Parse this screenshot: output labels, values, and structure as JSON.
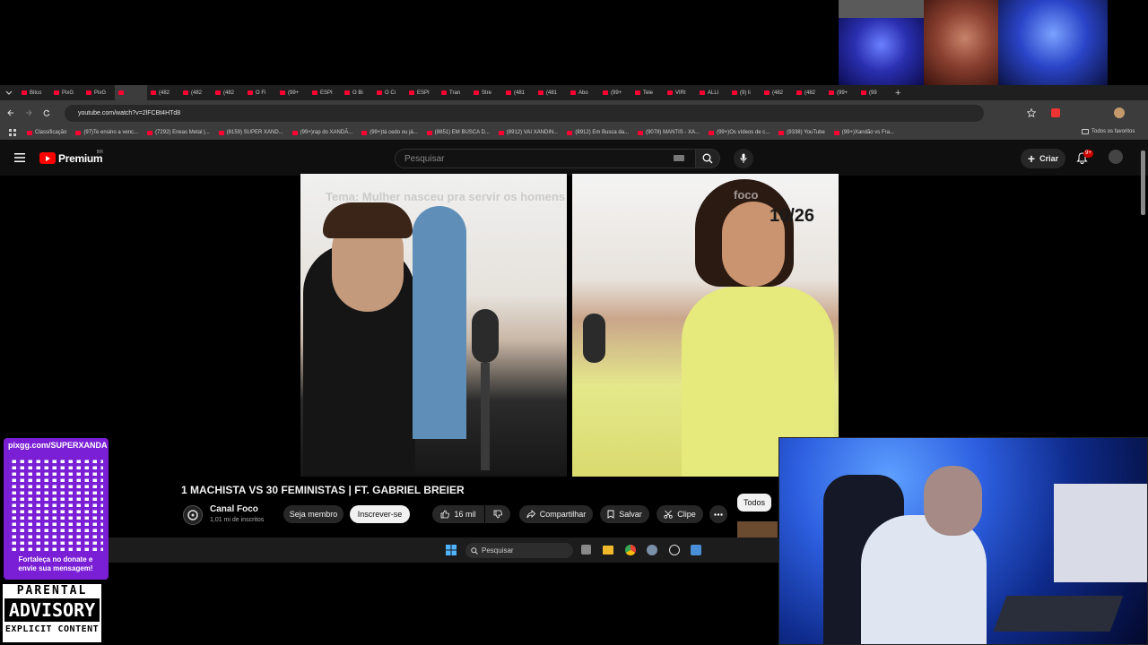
{
  "browser": {
    "tabs": [
      "Bitco",
      "PixG",
      "PixG",
      "",
      "(482",
      "(482",
      "(482",
      "O Fi",
      "(99+",
      "ESPI",
      "O Bi",
      "O Ci",
      "ESPI",
      "Tran",
      "Stre",
      "(481",
      "(481",
      "Abo",
      "(99+",
      "Tele",
      "VIRI",
      "ALLI",
      "(9) li",
      "(482",
      "(482",
      "(99+",
      "(99"
    ],
    "url": "youtube.com/watch?v=2lFCBt4HTd8",
    "bookmarks": [
      "Classificação",
      "(97)Te ensino a venc...",
      "(7292) Eneas Metal |...",
      "(8159) SUPER XAND...",
      "(99+)rap do XANDÃ...",
      "(99+)tá cedo ou já...",
      "(8851) EM BUSCA D...",
      "(8912) VAI XANDIN...",
      "(8912) Em Busca da...",
      "(9078) MANTIS - XA...",
      "(99+)Os vídeos de c...",
      "(9338) YouTube",
      "(99+)Xandão vs Fra..."
    ],
    "all_favorites": "Todos os favoritos"
  },
  "youtube": {
    "logo_text": "Premium",
    "logo_badge": "BR",
    "search_placeholder": "Pesquisar",
    "create_label": "Criar",
    "notif_count": "9+"
  },
  "video": {
    "overlay_text": "Tema: Mulher nasceu pra servir os homens",
    "score": "10/26",
    "brand": "foco",
    "title": "1 MACHISTA VS 30 FEMINISTAS | FT. GABRIEL BREIER",
    "channel": "Canal Foco",
    "subscribers": "1,01 mi de inscritos",
    "member_label": "Seja membro",
    "subscribe_label": "Inscrever-se",
    "likes": "16 mil",
    "share_label": "Compartilhar",
    "save_label": "Salvar",
    "clip_label": "Clipe",
    "filter_chip": "Todos"
  },
  "taskbar": {
    "search_placeholder": "Pesquisar"
  },
  "overlay": {
    "qr_url": "pixgg.com/SUPERXANDA",
    "qr_caption": "Fortaleça no donate e envie sua mensagem!",
    "advisory_top": "PARENTAL",
    "advisory_mid": "ADVISORY",
    "advisory_bottom": "EXPLICIT CONTENT"
  },
  "colors": {
    "yt_red": "#ff0000",
    "purple": "#7a1fd6",
    "bg": "#000000"
  }
}
